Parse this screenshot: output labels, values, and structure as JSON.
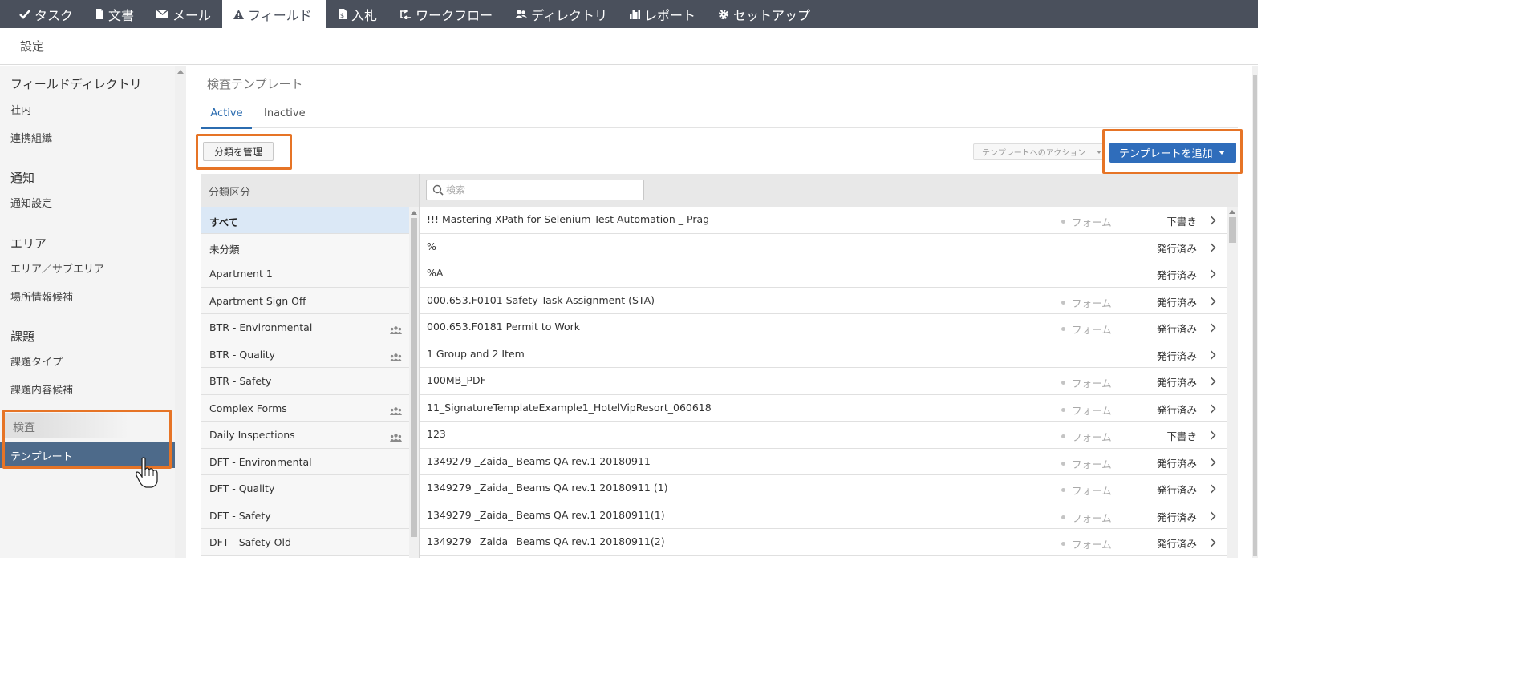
{
  "nav": {
    "items": [
      {
        "label": "タスク",
        "icon": "check-icon"
      },
      {
        "label": "文書",
        "icon": "document-icon"
      },
      {
        "label": "メール",
        "icon": "mail-icon"
      },
      {
        "label": "フィールド",
        "icon": "warning-icon",
        "active": true
      },
      {
        "label": "入札",
        "icon": "bid-icon"
      },
      {
        "label": "ワークフロー",
        "icon": "workflow-icon"
      },
      {
        "label": "ディレクトリ",
        "icon": "people-icon"
      },
      {
        "label": "レポート",
        "icon": "bar-chart-icon"
      },
      {
        "label": "セットアップ",
        "icon": "gear-icon"
      }
    ]
  },
  "settings": {
    "title": "設定"
  },
  "sidebar": {
    "field_directory": {
      "title": "フィールドディレクトリ",
      "items": [
        "社内",
        "連携組織"
      ]
    },
    "notifications": {
      "title": "通知",
      "items": [
        "通知設定"
      ]
    },
    "area": {
      "title": "エリア",
      "items": [
        "エリア／サブエリア",
        "場所情報候補"
      ]
    },
    "issues": {
      "title": "課題",
      "items": [
        "課題タイプ",
        "課題内容候補"
      ]
    },
    "inspection": {
      "title": "検査",
      "items": [
        "テンプレート"
      ]
    }
  },
  "main": {
    "title": "検査テンプレート",
    "tabs": {
      "active": "Active",
      "inactive": "Inactive"
    },
    "manage_button": "分類を管理",
    "actions_button": "テンプレートへのアクション",
    "add_button": "テンプレートを追加",
    "category_header": "分類区分",
    "search_placeholder": "検索"
  },
  "categories": [
    {
      "label": "すべて",
      "group": false,
      "selected": true
    },
    {
      "label": "未分類",
      "group": false
    },
    {
      "label": "Apartment 1",
      "group": false
    },
    {
      "label": "Apartment Sign Off",
      "group": false
    },
    {
      "label": "BTR - Environmental",
      "group": true
    },
    {
      "label": "BTR - Quality",
      "group": true
    },
    {
      "label": "BTR - Safety",
      "group": false
    },
    {
      "label": "Complex Forms",
      "group": true
    },
    {
      "label": "Daily Inspections",
      "group": true
    },
    {
      "label": "DFT - Environmental",
      "group": false
    },
    {
      "label": "DFT - Quality",
      "group": false
    },
    {
      "label": "DFT - Safety",
      "group": false
    },
    {
      "label": "DFT - Safety Old",
      "group": false
    }
  ],
  "templates": [
    {
      "name": "!!! Mastering XPath for Selenium Test Automation _ Prag",
      "form": "フォーム",
      "status": "下書き"
    },
    {
      "name": "%",
      "form": "",
      "status": "発行済み"
    },
    {
      "name": "%A",
      "form": "",
      "status": "発行済み"
    },
    {
      "name": "000.653.F0101 Safety Task Assignment (STA)",
      "form": "フォーム",
      "status": "発行済み"
    },
    {
      "name": "000.653.F0181 Permit to Work",
      "form": "フォーム",
      "status": "発行済み"
    },
    {
      "name": "1 Group and 2 Item",
      "form": "",
      "status": "発行済み"
    },
    {
      "name": "100MB_PDF",
      "form": "フォーム",
      "status": "発行済み"
    },
    {
      "name": "11_SignatureTemplateExample1_HotelVipResort_060618",
      "form": "フォーム",
      "status": "発行済み"
    },
    {
      "name": "123",
      "form": "フォーム",
      "status": "下書き"
    },
    {
      "name": "1349279 _Zaida_ Beams QA rev.1 20180911",
      "form": "フォーム",
      "status": "発行済み"
    },
    {
      "name": "1349279 _Zaida_ Beams QA rev.1 20180911 (1)",
      "form": "フォーム",
      "status": "発行済み"
    },
    {
      "name": "1349279 _Zaida_ Beams QA rev.1 20180911(1)",
      "form": "フォーム",
      "status": "発行済み"
    },
    {
      "name": "1349279 _Zaida_ Beams QA rev.1 20180911(2)",
      "form": "フォーム",
      "status": "発行済み"
    }
  ],
  "colors": {
    "nav_bg": "#4a505c",
    "accent": "#2f6dbb",
    "highlight": "#e67426",
    "selected_sidebar": "#4d6a8a"
  }
}
